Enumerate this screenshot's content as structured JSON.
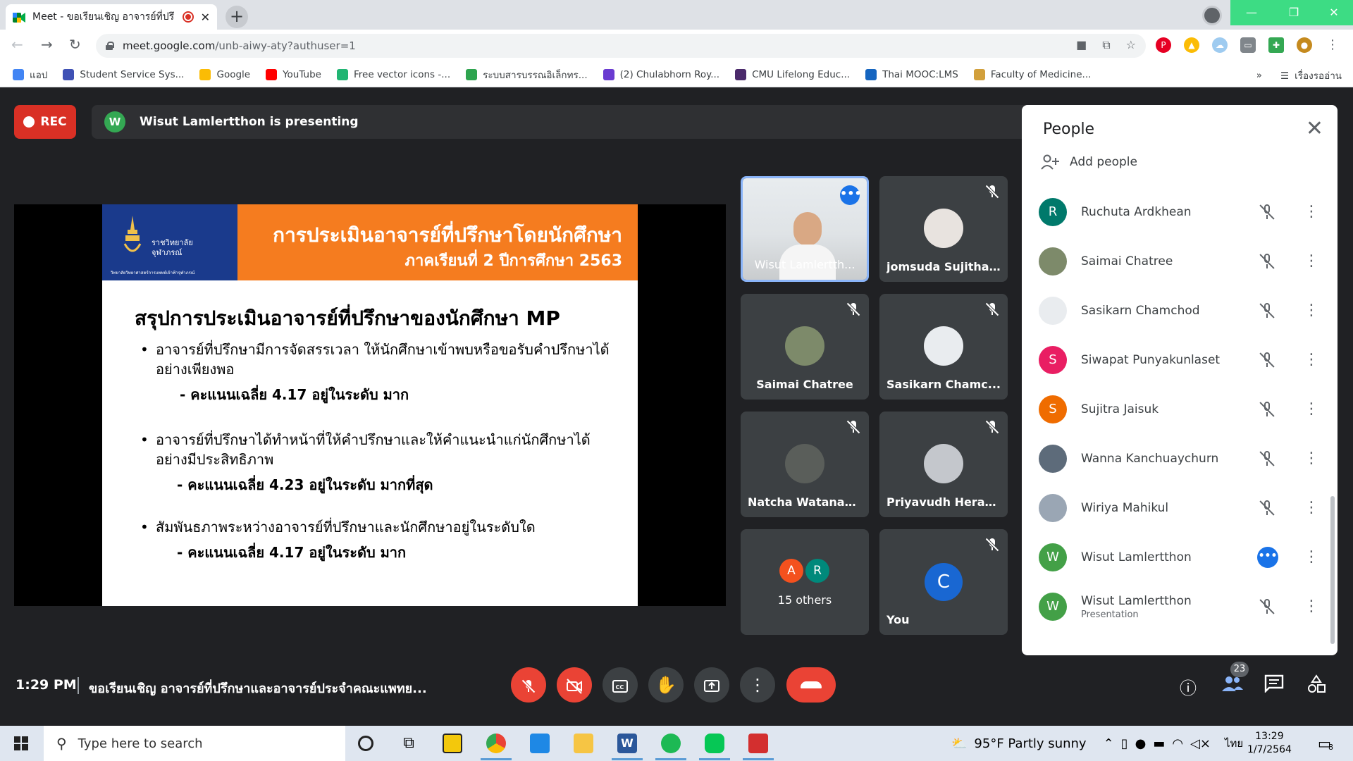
{
  "browser": {
    "tab_title": "Meet - ขอเรียนเชิญ อาจารย์ที่ปรึ",
    "url_host": "meet.google.com",
    "url_path": "/unb-aiwy-aty?authuser=1"
  },
  "bookmarks": {
    "items": [
      {
        "label": "แอป",
        "color": "#4285f4"
      },
      {
        "label": "Student Service Sys...",
        "color": "#3f51b5"
      },
      {
        "label": "Google",
        "color": "#fbbc05"
      },
      {
        "label": "YouTube",
        "color": "#ff0000"
      },
      {
        "label": "Free vector icons -...",
        "color": "#21b573"
      },
      {
        "label": "ระบบสารบรรณอิเล็กทร...",
        "color": "#2ea44f"
      },
      {
        "label": "(2) Chulabhorn Roy...",
        "color": "#6a3bd1"
      },
      {
        "label": "CMU Lifelong Educ...",
        "color": "#4b2a6b"
      },
      {
        "label": "Thai MOOC:LMS",
        "color": "#1565c0"
      },
      {
        "label": "Faculty of Medicine...",
        "color": "#d2a03c"
      }
    ],
    "overflow": "»",
    "reading_list": "เรื่องรออ่าน"
  },
  "meet": {
    "rec_label": "REC",
    "presenter_initial": "W",
    "presenting_text": "Wisut Lamlertthon is presenting"
  },
  "slide": {
    "logo_text_1": "ราชวิทยาลัย",
    "logo_text_2": "จุฬาภรณ์",
    "logo_text_bottom": "วิทยาลัยวิทยาศาสตร์การแพทย์เจ้าฟ้าจุฬาภรณ์",
    "header_line_1": "การประเมินอาจารย์ที่ปรึกษาโดยนักศึกษา",
    "header_line_2": "ภาคเรียนที่ 2  ปีการศึกษา 2563",
    "heading": "สรุปการประเมินอาจารย์ที่ปรึกษาของนักศึกษา MP",
    "items": [
      {
        "text": "อาจารย์ที่ปรึกษามีการจัดสรรเวลา ให้นักศึกษาเข้าพบหรือขอรับคำปรึกษาได้อย่างเพียงพอ",
        "score": "-  คะแนนเฉลี่ย  4.17  อยู่ในระดับ มาก"
      },
      {
        "text": "อาจารย์ที่ปรึกษาได้ทำหน้าที่ให้คำปรึกษาและให้คำแนะนำแก่นักศึกษาได้อย่างมีประสิทธิภาพ",
        "score": "-  คะแนนเฉลี่ย  4.23  อยู่ในระดับ มากที่สุด"
      },
      {
        "text": "สัมพันธภาพระหว่างอาจารย์ที่ปรึกษาและนักศึกษาอยู่ในระดับใด",
        "score": "- คะแนนเฉลี่ย  4.17  อยู่ในระดับ มาก"
      }
    ]
  },
  "tiles": [
    {
      "name": "Wisut Lamlertth...",
      "type": "video"
    },
    {
      "name": "jomsuda Sujitham",
      "type": "photo",
      "color": "#e8e3df"
    },
    {
      "name": "Saimai Chatree",
      "type": "photo",
      "color": "#7d8a6a"
    },
    {
      "name": "Sasikarn Chamc...",
      "type": "photo",
      "color": "#e9ecef"
    },
    {
      "name": "Natcha Watanap...",
      "type": "photo",
      "color": "#5a5e5a"
    },
    {
      "name": "Priyavudh Herab...",
      "type": "photo",
      "color": "#c4c7cc"
    },
    {
      "name": "15 others",
      "type": "group",
      "initials": [
        "A",
        "R"
      ]
    },
    {
      "name": "You",
      "type": "initial",
      "initial": "C",
      "color": "#1967d2"
    }
  ],
  "people": {
    "title": "People",
    "add_label": "Add people",
    "list": [
      {
        "name": "Ruchuta Ardkhean",
        "initial": "R",
        "color": "#00796b",
        "status": "muted"
      },
      {
        "name": "Saimai Chatree",
        "initial": "",
        "color": "#7d8a6a",
        "status": "muted"
      },
      {
        "name": "Sasikarn Chamchod",
        "initial": "",
        "color": "#e9ecef",
        "status": "muted"
      },
      {
        "name": "Siwapat Punyakunlaset",
        "initial": "S",
        "color": "#e91e63",
        "status": "muted"
      },
      {
        "name": "Sujitra Jaisuk",
        "initial": "S",
        "color": "#ef6c00",
        "status": "muted"
      },
      {
        "name": "Wanna Kanchuaychurn",
        "initial": "",
        "color": "#5d6b7a",
        "status": "muted"
      },
      {
        "name": "Wiriya Mahikul",
        "initial": "",
        "color": "#9aa6b4",
        "status": "muted"
      },
      {
        "name": "Wisut Lamlertthon",
        "initial": "W",
        "color": "#43a047",
        "status": "speaking"
      },
      {
        "name": "Wisut Lamlertthon",
        "sub": "Presentation",
        "initial": "W",
        "color": "#43a047",
        "status": "audio-off"
      }
    ]
  },
  "bottom": {
    "time": "1:29 PM",
    "meeting_title": "ขอเรียนเชิญ อาจารย์ที่ปรึกษาและอาจารย์ประจำคณะแพทย...",
    "people_count": "23"
  },
  "taskbar": {
    "search_placeholder": "Type here to search",
    "weather": "95°F  Partly sunny",
    "lang": "ไทย",
    "time": "13:29",
    "date": "1/7/2564",
    "notif_count": "8"
  }
}
